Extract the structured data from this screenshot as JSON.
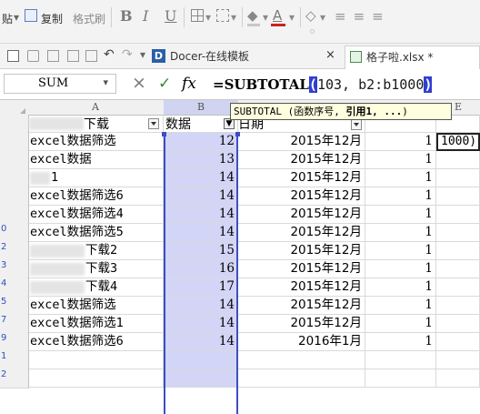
{
  "ribbon": {
    "paste_fragment": "贴",
    "copy_label": "复制",
    "format_painter_label": "格式刷",
    "bold_label": "B",
    "italic_label": "I",
    "underline_label": "U",
    "font_color_label": "A"
  },
  "tabs": {
    "docer_label": "Docer-在线模板",
    "docer_close": "×",
    "file_label": "格子啦.xlsx *"
  },
  "formula_bar": {
    "name_box": "SUM",
    "cancel_symbol": "×",
    "confirm_symbol": "✓",
    "fx_label": "fx",
    "formula_prefix": "=SUBTOTAL",
    "formula_open": "(",
    "formula_args": "103, b2:b1000",
    "formula_close": ")"
  },
  "tooltip": {
    "text_prefix": "SUBTOTAL (函数序号, ",
    "text_bold": "引用1, ...",
    "text_suffix": ")"
  },
  "grid": {
    "columns": [
      "A",
      "B",
      "C",
      "D",
      "E"
    ],
    "header": {
      "a_suffix": "下载",
      "b": "数据",
      "c": "日期"
    },
    "e_edit_text": "1000)",
    "rows": [
      {
        "num": "",
        "a": "excel数据筛选",
        "b": "12",
        "c": "2015年12月",
        "d": "1"
      },
      {
        "num": "",
        "a": "excel数据",
        "b": "13",
        "c": "2015年12月",
        "d": "1"
      },
      {
        "num": "",
        "a": "1",
        "b": "14",
        "c": "2015年12月",
        "d": "1"
      },
      {
        "num": "",
        "a": "excel数据筛选6",
        "b": "14",
        "c": "2015年12月",
        "d": "1"
      },
      {
        "num": "",
        "a": "excel数据筛选4",
        "b": "14",
        "c": "2015年12月",
        "d": "1"
      },
      {
        "num": "0",
        "a": "excel数据筛选5",
        "b": "14",
        "c": "2015年12月",
        "d": "1"
      },
      {
        "num": "2",
        "a": "下载2",
        "b": "15",
        "c": "2015年12月",
        "d": "1"
      },
      {
        "num": "3",
        "a": "下载3",
        "b": "16",
        "c": "2015年12月",
        "d": "1"
      },
      {
        "num": "4",
        "a": "下载4",
        "b": "17",
        "c": "2015年12月",
        "d": "1"
      },
      {
        "num": "5",
        "a": "excel数据筛选",
        "b": "14",
        "c": "2015年12月",
        "d": "1"
      },
      {
        "num": "7",
        "a": "excel数据筛选1",
        "b": "14",
        "c": "2015年12月",
        "d": "1"
      },
      {
        "num": "9",
        "a": "excel数据筛选6",
        "b": "14",
        "c": "2016年1月",
        "d": "1"
      },
      {
        "num": "1",
        "a": "",
        "b": "",
        "c": "",
        "d": ""
      },
      {
        "num": "2",
        "a": "",
        "b": "",
        "c": "",
        "d": ""
      }
    ]
  },
  "colors": {
    "selection": "#d3d5f7",
    "selection_border": "#3b4fc4",
    "formula_highlight": "#2f3fd0",
    "row_number": "#3050c0",
    "tooltip_bg": "#ffffdf"
  }
}
